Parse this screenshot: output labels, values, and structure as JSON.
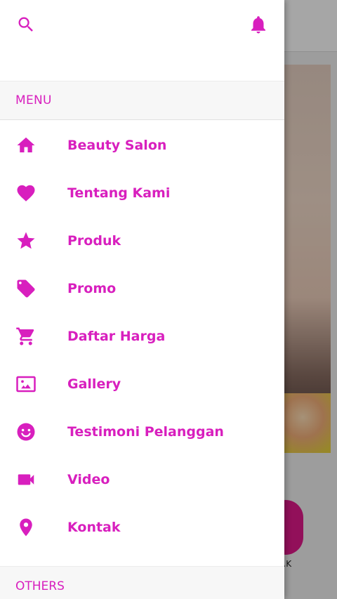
{
  "theme": {
    "accent": "#d81fbe"
  },
  "background_app": {
    "tab_label_partial": "AK"
  },
  "drawer": {
    "section_menu": "MENU",
    "section_others": "OTHERS",
    "items": [
      {
        "label": "Beauty Salon",
        "icon": "home-icon"
      },
      {
        "label": "Tentang Kami",
        "icon": "heart-icon"
      },
      {
        "label": "Produk",
        "icon": "star-icon"
      },
      {
        "label": "Promo",
        "icon": "tag-icon"
      },
      {
        "label": "Daftar Harga",
        "icon": "cart-icon"
      },
      {
        "label": "Gallery",
        "icon": "image-icon"
      },
      {
        "label": "Testimoni Pelanggan",
        "icon": "smile-icon"
      },
      {
        "label": "Video",
        "icon": "video-icon"
      },
      {
        "label": "Kontak",
        "icon": "location-pin-icon"
      }
    ]
  }
}
